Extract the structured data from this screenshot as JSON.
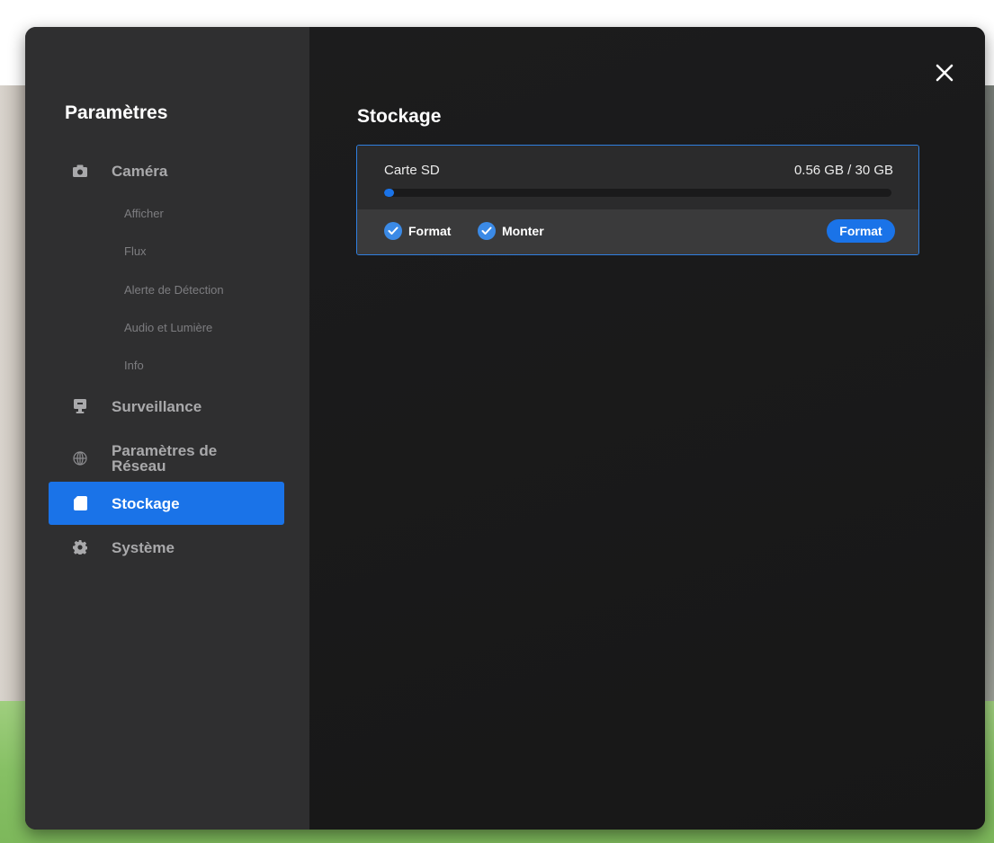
{
  "sidebar": {
    "title": "Paramètres",
    "items": [
      {
        "label": "Caméra",
        "icon": "camera-icon"
      },
      {
        "label": "Surveillance",
        "icon": "monitor-icon"
      },
      {
        "label": "Paramètres de Réseau",
        "icon": "globe-icon"
      },
      {
        "label": "Stockage",
        "icon": "sd-card-icon",
        "active": true
      },
      {
        "label": "Système",
        "icon": "gear-icon"
      }
    ],
    "camera_subitems": [
      "Afficher",
      "Flux",
      "Alerte de Détection",
      "Audio et Lumière",
      "Info"
    ]
  },
  "content": {
    "title": "Stockage",
    "storage": {
      "label": "Carte SD",
      "usage_text": "0.56 GB / 30 GB",
      "used_gb": 0.56,
      "total_gb": 30,
      "options": [
        {
          "label": "Format",
          "checked": true
        },
        {
          "label": "Monter",
          "checked": true
        }
      ],
      "format_button_label": "Format"
    }
  },
  "colors": {
    "accent": "#1a73e8",
    "sidebar_bg": "#2f2f30",
    "main_bg": "#1b1b1c"
  }
}
